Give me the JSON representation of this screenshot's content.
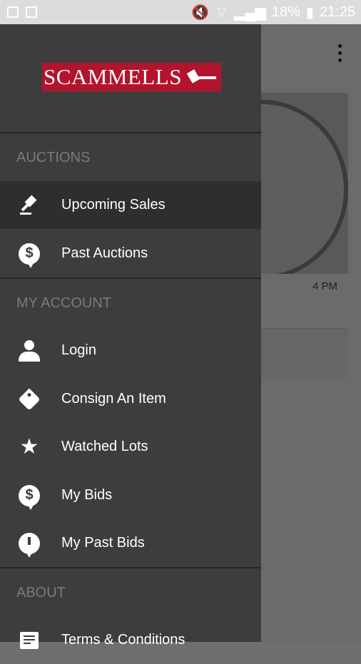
{
  "status": {
    "battery": "18%",
    "time": "21:25"
  },
  "background": {
    "time_label": "4 PM"
  },
  "drawer": {
    "logo_text": "SCAMMELLS",
    "sections": {
      "auctions": "AUCTIONS",
      "my_account": "MY ACCOUNT",
      "about": "ABOUT"
    },
    "items": {
      "upcoming_sales": "Upcoming Sales",
      "past_auctions": "Past Auctions",
      "login": "Login",
      "consign_item": "Consign An Item",
      "watched_lots": "Watched Lots",
      "my_bids": "My Bids",
      "my_past_bids": "My Past Bids",
      "terms": "Terms & Conditions"
    }
  }
}
